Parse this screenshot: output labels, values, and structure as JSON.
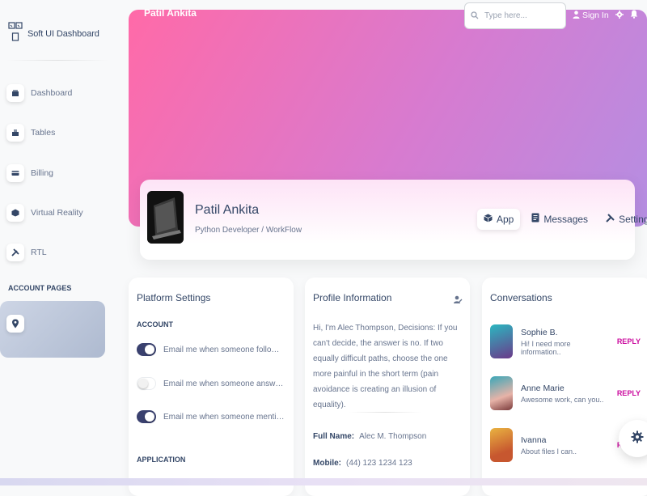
{
  "brand": {
    "title": "Soft UI Dashboard"
  },
  "sidebar": {
    "items": [
      {
        "label": "Dashboard",
        "icon": "shop-icon"
      },
      {
        "label": "Tables",
        "icon": "office-icon"
      },
      {
        "label": "Billing",
        "icon": "credit-card-icon"
      },
      {
        "label": "Virtual Reality",
        "icon": "box-icon"
      },
      {
        "label": "RTL",
        "icon": "settings-tool-icon"
      }
    ],
    "section_title": "ACCOUNT PAGES",
    "active_icon": "map-pin-icon"
  },
  "header": {
    "user": "Patil Ankita",
    "search_placeholder": "Type here...",
    "signin_label": "Sign In"
  },
  "profile": {
    "name": "Patil Ankita",
    "role": "Python Developer / WorkFlow",
    "tabs": [
      {
        "label": "App",
        "icon": "cube-icon"
      },
      {
        "label": "Messages",
        "icon": "document-icon"
      },
      {
        "label": "Settings",
        "icon": "settings-icon"
      }
    ]
  },
  "platform": {
    "title": "Platform Settings",
    "account_title": "ACCOUNT",
    "toggles": [
      {
        "label": "Email me when someone follows me",
        "on": true
      },
      {
        "label": "Email me when someone answers on my post",
        "on": false
      },
      {
        "label": "Email me when someone mentions me",
        "on": true
      }
    ],
    "application_title": "APPLICATION"
  },
  "info": {
    "title": "Profile Information",
    "bio": "Hi, I'm Alec Thompson, Decisions: If you can't decide, the answer is no. If two equally difficult paths, choose the one more painful in the short term (pain avoidance is creating an illusion of equality).",
    "full_name_label": "Full Name:",
    "full_name": "Alec M. Thompson",
    "mobile_label": "Mobile:",
    "mobile": "(44) 123 1234 123"
  },
  "conversations": {
    "title": "Conversations",
    "reply_label": "REPLY",
    "items": [
      {
        "name": "Sophie B.",
        "msg": "Hi! I need more information..",
        "color": "#3cc1c7"
      },
      {
        "name": "Anne Marie",
        "msg": "Awesome work, can you..",
        "color": "#d88aa0"
      },
      {
        "name": "Ivanna",
        "msg": "About files I can..",
        "color": "#e0a23a"
      }
    ]
  },
  "colors": {
    "accent": "#cb0c9f",
    "dark": "#344767",
    "toggle_on": "#3a416f"
  }
}
